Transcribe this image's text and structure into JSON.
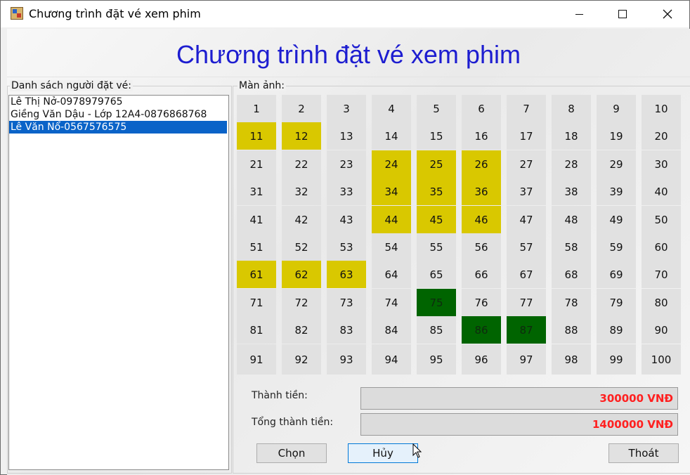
{
  "window": {
    "title": "Chương trình đặt vé xem phim",
    "controls": {
      "minimize": "minimize",
      "maximize": "maximize",
      "close": "close"
    }
  },
  "header": {
    "title": "Chương trình đặt vé xem phim"
  },
  "customers": {
    "group_label": "Danh sách người đặt vé:",
    "items": [
      "Lê Thị Nở-0978979765",
      "Giềng Văn Dậu - Lớp 12A4-0876868768",
      "Lê Văn Nổ-0567576575"
    ],
    "selected_index": 2
  },
  "screen": {
    "group_label": "Màn ảnh:",
    "seat_count": 100,
    "selected_seats": [
      11,
      12,
      24,
      25,
      26,
      34,
      35,
      36,
      44,
      45,
      46,
      61,
      62,
      63
    ],
    "booked_seats": [
      75,
      86,
      87
    ],
    "colors": {
      "normal": "#e1e1e1",
      "selected": "#d9c800",
      "booked": "#006400"
    }
  },
  "totals": {
    "subtotal_label": "Thành tiền:",
    "subtotal_value": "300000 VNĐ",
    "total_label": "Tổng thành tiền:",
    "total_value": "1400000 VNĐ"
  },
  "buttons": {
    "choose": "Chọn",
    "cancel": "Hủy",
    "exit": "Thoát"
  }
}
